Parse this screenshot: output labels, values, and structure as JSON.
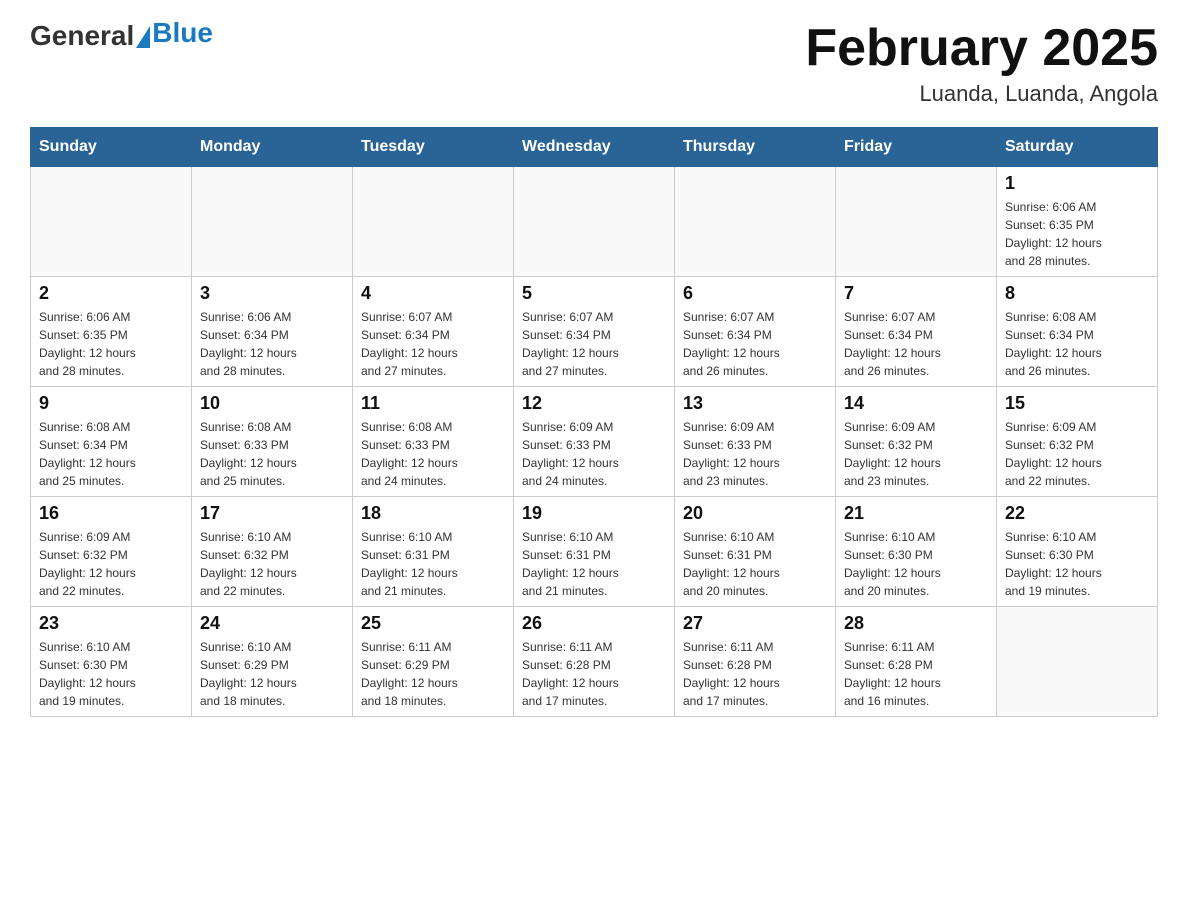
{
  "header": {
    "logo_general": "General",
    "logo_blue": "Blue",
    "month_year": "February 2025",
    "location": "Luanda, Luanda, Angola"
  },
  "weekdays": [
    "Sunday",
    "Monday",
    "Tuesday",
    "Wednesday",
    "Thursday",
    "Friday",
    "Saturday"
  ],
  "weeks": [
    [
      {
        "day": "",
        "info": ""
      },
      {
        "day": "",
        "info": ""
      },
      {
        "day": "",
        "info": ""
      },
      {
        "day": "",
        "info": ""
      },
      {
        "day": "",
        "info": ""
      },
      {
        "day": "",
        "info": ""
      },
      {
        "day": "1",
        "info": "Sunrise: 6:06 AM\nSunset: 6:35 PM\nDaylight: 12 hours\nand 28 minutes."
      }
    ],
    [
      {
        "day": "2",
        "info": "Sunrise: 6:06 AM\nSunset: 6:35 PM\nDaylight: 12 hours\nand 28 minutes."
      },
      {
        "day": "3",
        "info": "Sunrise: 6:06 AM\nSunset: 6:34 PM\nDaylight: 12 hours\nand 28 minutes."
      },
      {
        "day": "4",
        "info": "Sunrise: 6:07 AM\nSunset: 6:34 PM\nDaylight: 12 hours\nand 27 minutes."
      },
      {
        "day": "5",
        "info": "Sunrise: 6:07 AM\nSunset: 6:34 PM\nDaylight: 12 hours\nand 27 minutes."
      },
      {
        "day": "6",
        "info": "Sunrise: 6:07 AM\nSunset: 6:34 PM\nDaylight: 12 hours\nand 26 minutes."
      },
      {
        "day": "7",
        "info": "Sunrise: 6:07 AM\nSunset: 6:34 PM\nDaylight: 12 hours\nand 26 minutes."
      },
      {
        "day": "8",
        "info": "Sunrise: 6:08 AM\nSunset: 6:34 PM\nDaylight: 12 hours\nand 26 minutes."
      }
    ],
    [
      {
        "day": "9",
        "info": "Sunrise: 6:08 AM\nSunset: 6:34 PM\nDaylight: 12 hours\nand 25 minutes."
      },
      {
        "day": "10",
        "info": "Sunrise: 6:08 AM\nSunset: 6:33 PM\nDaylight: 12 hours\nand 25 minutes."
      },
      {
        "day": "11",
        "info": "Sunrise: 6:08 AM\nSunset: 6:33 PM\nDaylight: 12 hours\nand 24 minutes."
      },
      {
        "day": "12",
        "info": "Sunrise: 6:09 AM\nSunset: 6:33 PM\nDaylight: 12 hours\nand 24 minutes."
      },
      {
        "day": "13",
        "info": "Sunrise: 6:09 AM\nSunset: 6:33 PM\nDaylight: 12 hours\nand 23 minutes."
      },
      {
        "day": "14",
        "info": "Sunrise: 6:09 AM\nSunset: 6:32 PM\nDaylight: 12 hours\nand 23 minutes."
      },
      {
        "day": "15",
        "info": "Sunrise: 6:09 AM\nSunset: 6:32 PM\nDaylight: 12 hours\nand 22 minutes."
      }
    ],
    [
      {
        "day": "16",
        "info": "Sunrise: 6:09 AM\nSunset: 6:32 PM\nDaylight: 12 hours\nand 22 minutes."
      },
      {
        "day": "17",
        "info": "Sunrise: 6:10 AM\nSunset: 6:32 PM\nDaylight: 12 hours\nand 22 minutes."
      },
      {
        "day": "18",
        "info": "Sunrise: 6:10 AM\nSunset: 6:31 PM\nDaylight: 12 hours\nand 21 minutes."
      },
      {
        "day": "19",
        "info": "Sunrise: 6:10 AM\nSunset: 6:31 PM\nDaylight: 12 hours\nand 21 minutes."
      },
      {
        "day": "20",
        "info": "Sunrise: 6:10 AM\nSunset: 6:31 PM\nDaylight: 12 hours\nand 20 minutes."
      },
      {
        "day": "21",
        "info": "Sunrise: 6:10 AM\nSunset: 6:30 PM\nDaylight: 12 hours\nand 20 minutes."
      },
      {
        "day": "22",
        "info": "Sunrise: 6:10 AM\nSunset: 6:30 PM\nDaylight: 12 hours\nand 19 minutes."
      }
    ],
    [
      {
        "day": "23",
        "info": "Sunrise: 6:10 AM\nSunset: 6:30 PM\nDaylight: 12 hours\nand 19 minutes."
      },
      {
        "day": "24",
        "info": "Sunrise: 6:10 AM\nSunset: 6:29 PM\nDaylight: 12 hours\nand 18 minutes."
      },
      {
        "day": "25",
        "info": "Sunrise: 6:11 AM\nSunset: 6:29 PM\nDaylight: 12 hours\nand 18 minutes."
      },
      {
        "day": "26",
        "info": "Sunrise: 6:11 AM\nSunset: 6:28 PM\nDaylight: 12 hours\nand 17 minutes."
      },
      {
        "day": "27",
        "info": "Sunrise: 6:11 AM\nSunset: 6:28 PM\nDaylight: 12 hours\nand 17 minutes."
      },
      {
        "day": "28",
        "info": "Sunrise: 6:11 AM\nSunset: 6:28 PM\nDaylight: 12 hours\nand 16 minutes."
      },
      {
        "day": "",
        "info": ""
      }
    ]
  ]
}
